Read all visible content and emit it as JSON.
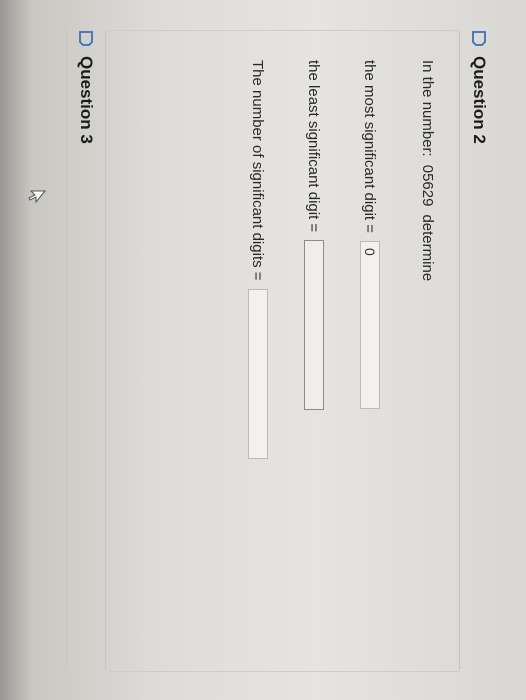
{
  "question2": {
    "title": "Question 2",
    "icon": "flag-outline-icon"
  },
  "question3": {
    "title": "Question 3",
    "icon": "flag-outline-icon"
  },
  "prompt": {
    "text": "In the number:",
    "number": "05629",
    "suffix": "determine"
  },
  "fields": {
    "most_label": "the most significant digit =",
    "most_value": "0",
    "least_label": "the least significant digit =",
    "least_value": "",
    "count_label": "The number of significant digits =",
    "count_value": ""
  },
  "cursor": {
    "icon": "mouse-pointer-icon"
  }
}
